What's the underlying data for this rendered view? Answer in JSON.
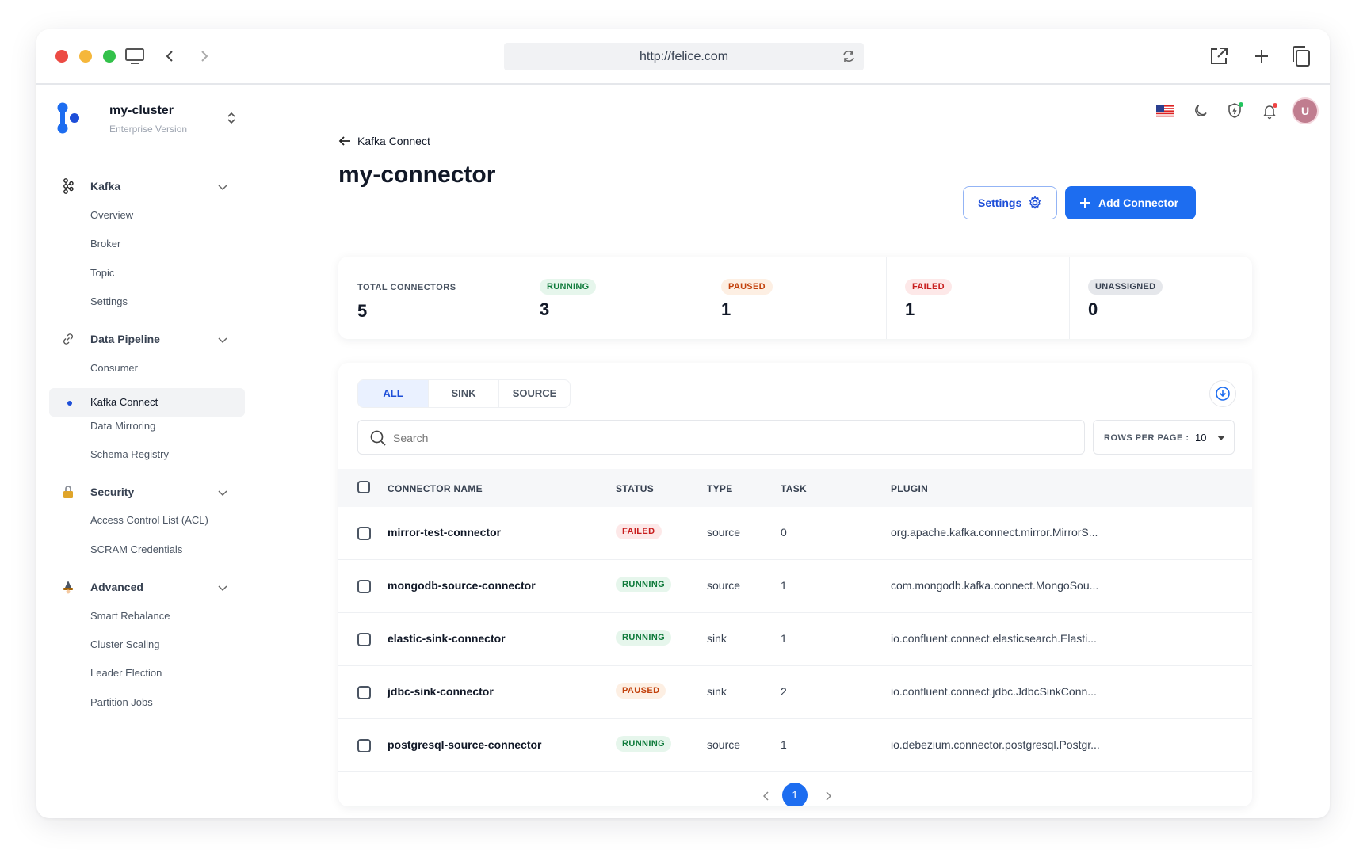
{
  "browser": {
    "url": "http://felice.com"
  },
  "brand": {
    "title": "my-cluster",
    "subtitle": "Enterprise Version"
  },
  "sidebar": {
    "sections": [
      {
        "label": "Kafka",
        "items": [
          "Overview",
          "Broker",
          "Topic",
          "Settings"
        ]
      },
      {
        "label": "Data Pipeline",
        "items": [
          "Consumer",
          "Kafka Connect",
          "Data Mirroring",
          "Schema Registry"
        ]
      },
      {
        "label": "Security",
        "items": [
          "Access Control List (ACL)",
          "SCRAM Credentials"
        ]
      },
      {
        "label": "Advanced",
        "items": [
          "Smart Rebalance",
          "Cluster Scaling",
          "Leader Election",
          "Partition Jobs"
        ]
      }
    ],
    "active_item": "Kafka Connect"
  },
  "header": {
    "avatar_letter": "U"
  },
  "page": {
    "breadcrumb": "Kafka Connect",
    "title": "my-connector",
    "settings_label": "Settings",
    "add_label": "Add Connector"
  },
  "stats": {
    "total_label": "TOTAL CONNECTORS",
    "total_value": "5",
    "running_label": "RUNNING",
    "running_value": "3",
    "paused_label": "PAUSED",
    "paused_value": "1",
    "failed_label": "FAILED",
    "failed_value": "1",
    "unassigned_label": "UNASSIGNED",
    "unassigned_value": "0"
  },
  "table": {
    "tabs": [
      "ALL",
      "SINK",
      "SOURCE"
    ],
    "active_tab": "ALL",
    "search_placeholder": "Search",
    "rows_per_page_label": "ROWS PER PAGE :",
    "rows_per_page_value": "10",
    "columns": [
      "CONNECTOR NAME",
      "STATUS",
      "TYPE",
      "TASK",
      "PLUGIN"
    ],
    "rows": [
      {
        "name": "mirror-test-connector",
        "status": "FAILED",
        "type": "source",
        "task": "0",
        "plugin": "org.apache.kafka.connect.mirror.MirrorS..."
      },
      {
        "name": "mongodb-source-connector",
        "status": "RUNNING",
        "type": "source",
        "task": "1",
        "plugin": "com.mongodb.kafka.connect.MongoSou..."
      },
      {
        "name": "elastic-sink-connector",
        "status": "RUNNING",
        "type": "sink",
        "task": "1",
        "plugin": "io.confluent.connect.elasticsearch.Elasti..."
      },
      {
        "name": "jdbc-sink-connector",
        "status": "PAUSED",
        "type": "sink",
        "task": "2",
        "plugin": "io.confluent.connect.jdbc.JdbcSinkConn..."
      },
      {
        "name": "postgresql-source-connector",
        "status": "RUNNING",
        "type": "source",
        "task": "1",
        "plugin": "io.debezium.connector.postgresql.Postgr..."
      }
    ],
    "pagination": {
      "current": "1"
    }
  },
  "colors": {
    "accent": "#1d6df0",
    "failed": "#c81e1e",
    "running": "#0e7a3a",
    "paused": "#c2410c"
  }
}
